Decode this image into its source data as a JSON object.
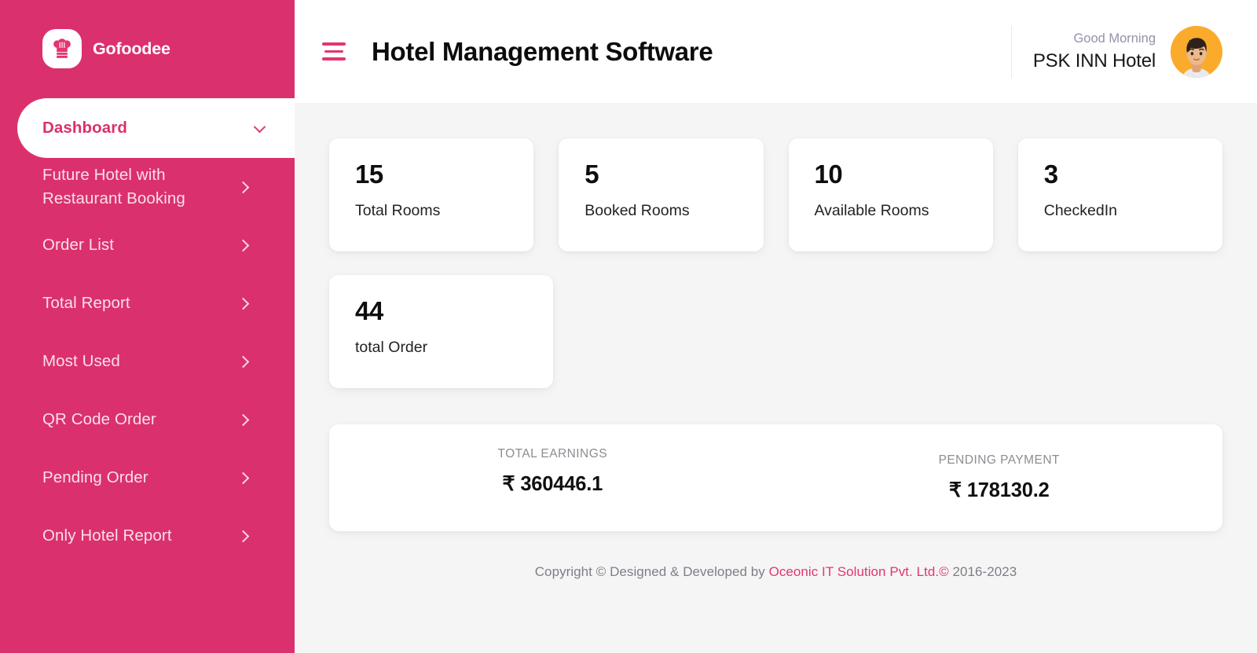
{
  "brand": {
    "name": "Gofoodee",
    "logo_icon": "chef-hat-icon",
    "bg_color": "#db306e"
  },
  "sidebar": {
    "items": [
      {
        "label": "Dashboard",
        "icon": "chevron-down-icon",
        "active": true
      },
      {
        "label": "Future Hotel with Restaurant Booking",
        "icon": "chevron-right-icon",
        "active": false
      },
      {
        "label": "Order List",
        "icon": "chevron-right-icon",
        "active": false
      },
      {
        "label": "Total Report",
        "icon": "chevron-right-icon",
        "active": false
      },
      {
        "label": "Most Used",
        "icon": "chevron-right-icon",
        "active": false
      },
      {
        "label": "QR Code Order",
        "icon": "chevron-right-icon",
        "active": false
      },
      {
        "label": "Pending Order",
        "icon": "chevron-right-icon",
        "active": false
      },
      {
        "label": "Only Hotel Report",
        "icon": "chevron-right-icon",
        "active": false
      }
    ]
  },
  "topbar": {
    "menu_icon": "hamburger-menu-icon",
    "title": "Hotel Management Software",
    "greeting": "Good Morning",
    "account_name": "PSK INN Hotel",
    "avatar_icon": "user-avatar-icon",
    "accent_color": "#e4356f"
  },
  "stats": [
    {
      "value": "15",
      "label": "Total Rooms"
    },
    {
      "value": "5",
      "label": "Booked Rooms"
    },
    {
      "value": "10",
      "label": "Available Rooms"
    },
    {
      "value": "3",
      "label": "CheckedIn"
    },
    {
      "value": "44",
      "label": "total Order"
    }
  ],
  "earnings": {
    "total": {
      "title": "TOTAL EARNINGS",
      "value": "₹ 360446.1"
    },
    "pending": {
      "title": "PENDING PAYMENT",
      "value": "₹ 178130.2"
    }
  },
  "footer": {
    "prefix": "Copyright © Designed & Developed by ",
    "company": "Oceonic IT Solution Pvt. Ltd.©",
    "suffix": " 2016-2023"
  }
}
